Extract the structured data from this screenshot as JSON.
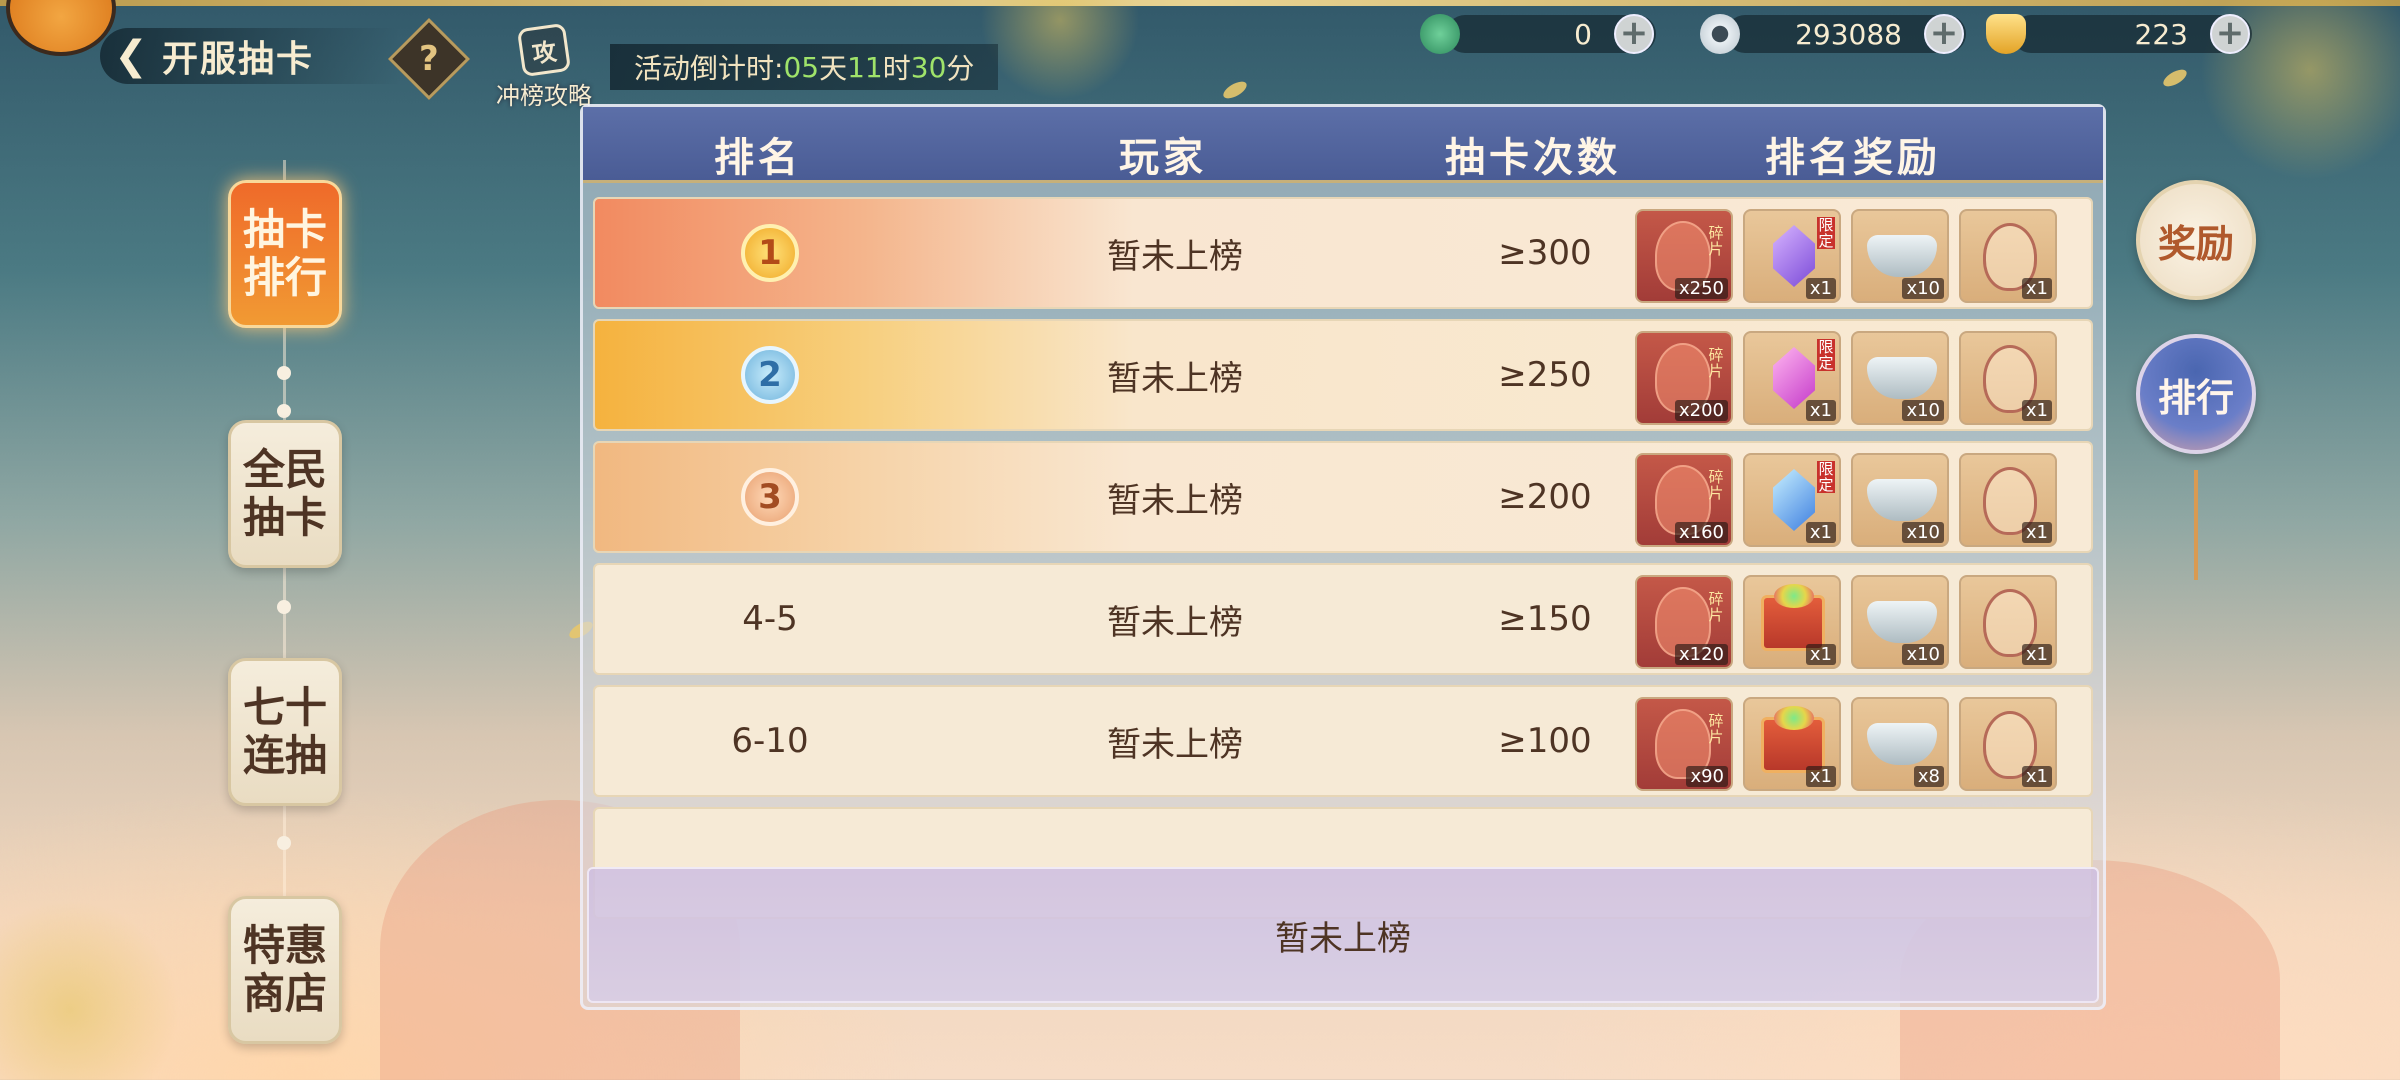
{
  "header": {
    "back_title": "开服抽卡",
    "help_label": "?",
    "guide_icon_text": "攻",
    "guide_label": "冲榜攻略",
    "countdown": {
      "prefix": "活动倒计时:",
      "days": "05",
      "days_unit": "天",
      "hours": "11",
      "hours_unit": "时",
      "minutes": "30",
      "minutes_unit": "分"
    }
  },
  "currencies": [
    {
      "icon": "jade-icon",
      "value": "0"
    },
    {
      "icon": "coin-icon",
      "value": "293088"
    },
    {
      "icon": "gold-ingot-icon",
      "value": "223"
    }
  ],
  "nav": {
    "items": [
      {
        "line1": "抽卡",
        "line2": "排行",
        "active": true
      },
      {
        "line1": "全民",
        "line2": "抽卡",
        "active": false
      },
      {
        "line1": "七十",
        "line2": "连抽",
        "active": false
      },
      {
        "line1": "特惠",
        "line2": "商店",
        "active": false
      }
    ]
  },
  "side_buttons": {
    "reward": "奖励",
    "rank": "排行"
  },
  "table": {
    "headers": [
      "排名",
      "玩家",
      "抽卡次数",
      "排名奖励"
    ],
    "rows": [
      {
        "rank": "1",
        "player": "暂未上榜",
        "count": "≥300",
        "rewards": [
          {
            "type": "fragment",
            "qty": "x250",
            "tag": "碎片"
          },
          {
            "type": "gem-purple",
            "qty": "x1",
            "tag": "限定"
          },
          {
            "type": "silver",
            "qty": "x10"
          },
          {
            "type": "pouch",
            "qty": "x1"
          }
        ]
      },
      {
        "rank": "2",
        "player": "暂未上榜",
        "count": "≥250",
        "rewards": [
          {
            "type": "fragment",
            "qty": "x200",
            "tag": "碎片"
          },
          {
            "type": "gem-pink",
            "qty": "x1",
            "tag": "限定"
          },
          {
            "type": "silver",
            "qty": "x10"
          },
          {
            "type": "pouch",
            "qty": "x1"
          }
        ]
      },
      {
        "rank": "3",
        "player": "暂未上榜",
        "count": "≥200",
        "rewards": [
          {
            "type": "fragment",
            "qty": "x160",
            "tag": "碎片"
          },
          {
            "type": "gem-blue",
            "qty": "x1",
            "tag": "限定"
          },
          {
            "type": "silver",
            "qty": "x10"
          },
          {
            "type": "pouch",
            "qty": "x1"
          }
        ]
      },
      {
        "rank": "4-5",
        "player": "暂未上榜",
        "count": "≥150",
        "rewards": [
          {
            "type": "fragment",
            "qty": "x120",
            "tag": "碎片"
          },
          {
            "type": "box",
            "qty": "x1"
          },
          {
            "type": "silver",
            "qty": "x10"
          },
          {
            "type": "pouch",
            "qty": "x1"
          }
        ]
      },
      {
        "rank": "6-10",
        "player": "暂未上榜",
        "count": "≥100",
        "rewards": [
          {
            "type": "fragment",
            "qty": "x90",
            "tag": "碎片"
          },
          {
            "type": "box",
            "qty": "x1"
          },
          {
            "type": "silver",
            "qty": "x8"
          },
          {
            "type": "pouch",
            "qty": "x1"
          }
        ]
      }
    ]
  },
  "my_rank": "暂未上榜"
}
